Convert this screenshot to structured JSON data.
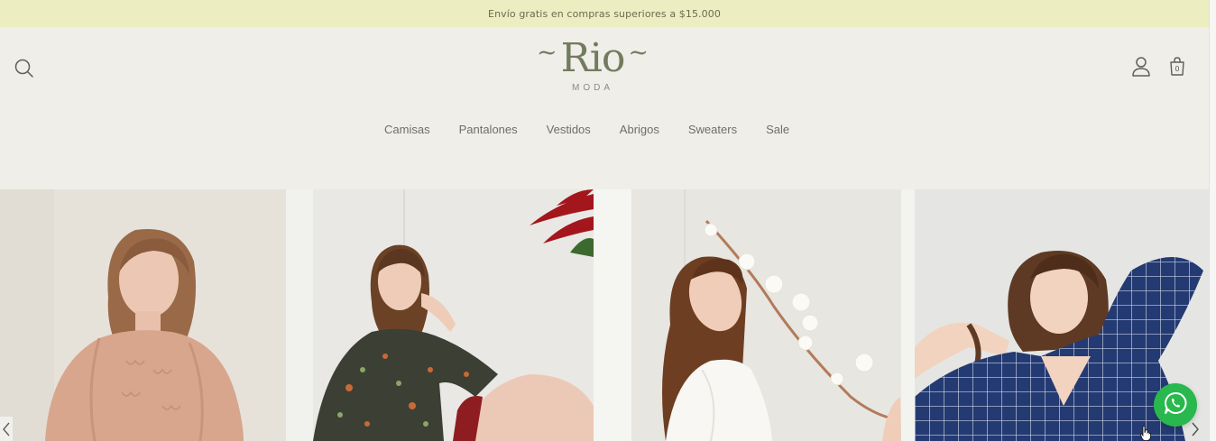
{
  "announcement": "Envío gratis en compras superiores a $15.000",
  "logo": {
    "name": "Rio",
    "tilde": "~",
    "tagline": "MODA"
  },
  "header_icons": [
    "search-icon",
    "user-icon",
    "cart-icon"
  ],
  "cart": {
    "count": "0"
  },
  "nav": [
    {
      "label": "Camisas"
    },
    {
      "label": "Pantalones"
    },
    {
      "label": "Vestidos"
    },
    {
      "label": "Abrigos"
    },
    {
      "label": "Sweaters"
    },
    {
      "label": "Sale"
    }
  ],
  "slider_icons": [
    "chevron-left-icon",
    "chevron-right-icon"
  ],
  "chat_icon": "whatsapp-icon",
  "colors": {
    "announcement_bg": "#ecedc0",
    "page_bg": "#efeee9",
    "logo": "#737b5f",
    "whatsapp": "#28b84d"
  }
}
